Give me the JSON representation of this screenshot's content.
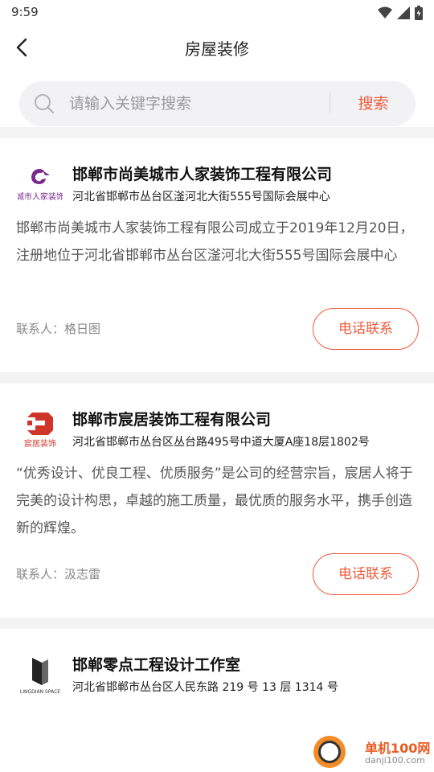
{
  "status_bar": {
    "time": "9:59"
  },
  "nav": {
    "title": "房屋装修"
  },
  "search": {
    "placeholder": "请输入关键字搜索",
    "button_label": "搜索"
  },
  "companies": [
    {
      "name": "邯郸市尚美城市人家装饰工程有限公司",
      "address": "河北省邯郸市丛台区滏河北大街555号国际会展中心",
      "description": "邯郸市尚美城市人家装饰工程有限公司成立于2019年12月20日，注册地位于河北省邯郸市丛台区滏河北大街555号国际会展中心",
      "contact": "联系人：格日图",
      "call_label": "电话联系",
      "logo_text": "城市人家装饰"
    },
    {
      "name": "邯郸市宸居装饰工程有限公司",
      "address": "河北省邯郸市丛台区丛台路495号中道大厦A座18层1802号",
      "description": "“优秀设计、优良工程、优质服务”是公司的经营宗旨，宸居人将于完美的设计构思，卓越的施工质量，最优质的服务水平，携手创造新的辉煌。",
      "contact": "联系人：汲志雷",
      "call_label": "电话联系",
      "logo_text": "宸居装饰"
    },
    {
      "name": "邯郸零点工程设计工作室",
      "address": "河北省邯郸市丛台区人民东路 219 号 13 层 1314 号",
      "logo_text": "LINGDIAN SPACE"
    }
  ],
  "watermark": {
    "title": "单机100网",
    "url": "danji100.com"
  },
  "colors": {
    "accent": "#f05a3a",
    "logo1": "#7a2a8c",
    "logo2": "#d0352a"
  }
}
